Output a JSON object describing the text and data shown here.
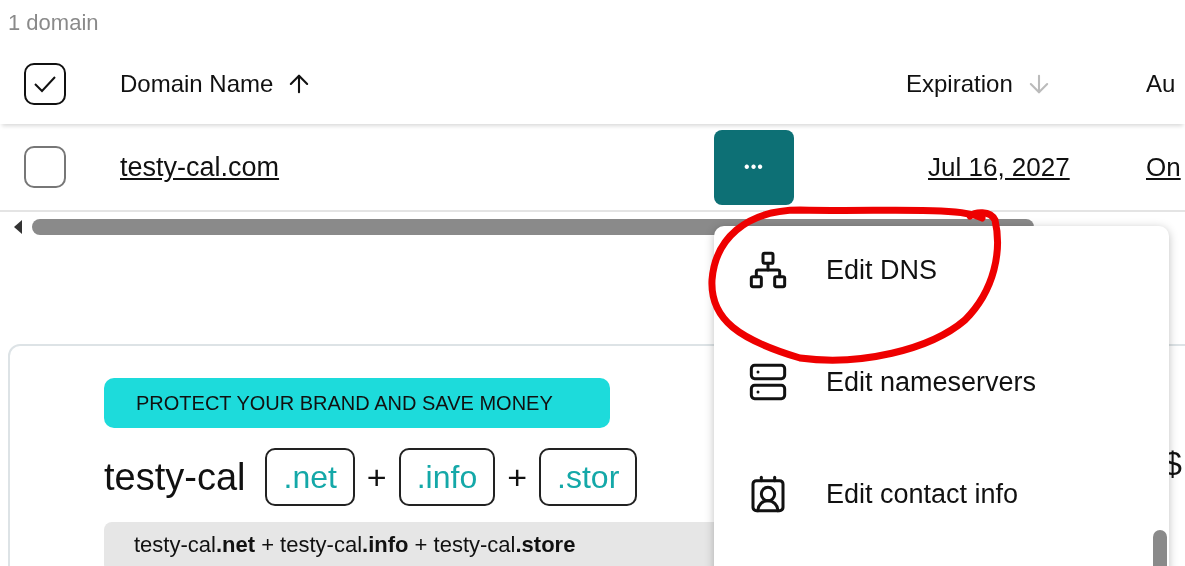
{
  "domain_count": "1 domain",
  "table": {
    "select_all": {
      "checked": true
    },
    "columns": [
      {
        "label": "Domain Name",
        "kind": "ascending",
        "sort_active": true
      },
      {
        "label": "Expiration",
        "kind": "descending",
        "sort_active": false
      },
      {
        "label": "Au",
        "kind": "plain"
      }
    ],
    "rows": [
      {
        "checked": false,
        "domain": "testy-cal.com",
        "more_button": "•••",
        "expiration": "Jul 16, 2027",
        "column_3": "On"
      }
    ]
  },
  "promo": {
    "badge": "PROTECT YOUR BRAND AND SAVE MONEY",
    "name": "testy-cal",
    "separator": "+",
    "tlds": [
      ".net",
      ".info",
      ".stor"
    ],
    "summary": "testy-cal**.net** + testy-cal**.info** + testy-cal**.store**",
    "price": "$"
  },
  "menu": {
    "items": [
      {
        "kind": "dns",
        "label": "Edit DNS"
      },
      {
        "kind": "nameservers",
        "label": "Edit nameservers"
      },
      {
        "kind": "contact",
        "label": "Edit contact info"
      }
    ]
  }
}
